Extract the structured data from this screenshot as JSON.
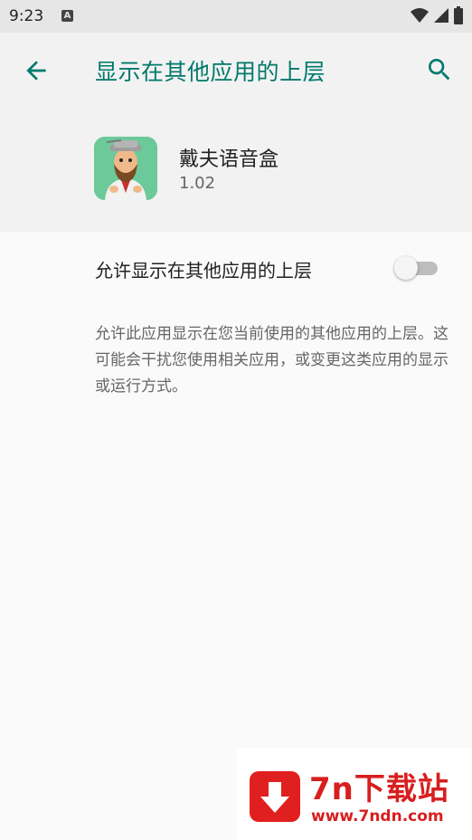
{
  "status_bar": {
    "time": "9:23",
    "notification_icon_letter": "A",
    "icons": [
      "wifi-icon",
      "signal-icon",
      "battery-icon"
    ]
  },
  "app_bar": {
    "title": "显示在其他应用的上层",
    "back_icon": "arrow-back-icon",
    "search_icon": "search-icon",
    "accent_color": "#00796b"
  },
  "app_info": {
    "name": "戴夫语音盒",
    "version": "1.02",
    "icon": "app-icon-crazy-dave"
  },
  "permission": {
    "toggle_label": "允许显示在其他应用的上层",
    "enabled": false,
    "description": "允许此应用显示在您当前使用的其他应用的上层。这可能会干扰您使用相关应用，或变更这类应用的显示或运行方式。"
  },
  "watermark": {
    "title": "7n下载站",
    "url": "www.7ndn.com",
    "color": "#d81e1e"
  }
}
